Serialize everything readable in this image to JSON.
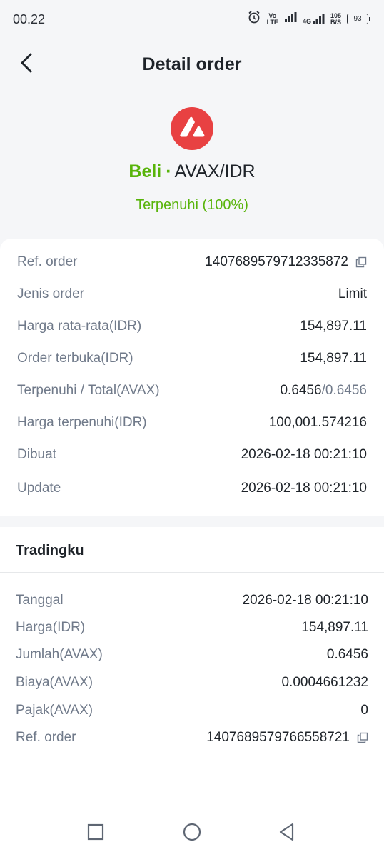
{
  "status_bar": {
    "time": "00.22",
    "volte": "Vo\nLTE",
    "net_4g": "4G",
    "speed": "105\nB/S",
    "battery": "93"
  },
  "header": {
    "title": "Detail order"
  },
  "order": {
    "side": "Beli",
    "separator": "·",
    "pair": "AVAX/IDR",
    "status": "Terpenuhi (100%)",
    "icon": "avalanche-logo",
    "colors": {
      "buy": "#58b40a",
      "avax": "#e84142"
    }
  },
  "details": {
    "ref_label": "Ref. order",
    "ref_value": "1407689579712335872",
    "type_label": "Jenis order",
    "type_value": "Limit",
    "avg_label": "Harga rata-rata(IDR)",
    "avg_value": "154,897.11",
    "open_label": "Order terbuka(IDR)",
    "open_value": "154,897.11",
    "filled_label": "Terpenuhi / Total(AVAX)",
    "filled_value": "0.6456",
    "total_value": "/0.6456",
    "filled_price_label": "Harga terpenuhi(IDR)",
    "filled_price_value": "100,001.574216",
    "created_label": "Dibuat",
    "created_value": "2026-02-18 00:21:10",
    "update_label": "Update",
    "update_value": "2026-02-18 00:21:10"
  },
  "trades": {
    "title": "Tradingku",
    "date_label": "Tanggal",
    "date_value": "2026-02-18 00:21:10",
    "price_label": "Harga(IDR)",
    "price_value": "154,897.11",
    "amount_label": "Jumlah(AVAX)",
    "amount_value": "0.6456",
    "fee_label": "Biaya(AVAX)",
    "fee_value": "0.0004661232",
    "tax_label": "Pajak(AVAX)",
    "tax_value": "0",
    "ref_label": "Ref. order",
    "ref_value": "1407689579766558721"
  },
  "nav": {
    "icons": [
      "square-recents-icon",
      "circle-home-icon",
      "triangle-back-icon"
    ]
  }
}
